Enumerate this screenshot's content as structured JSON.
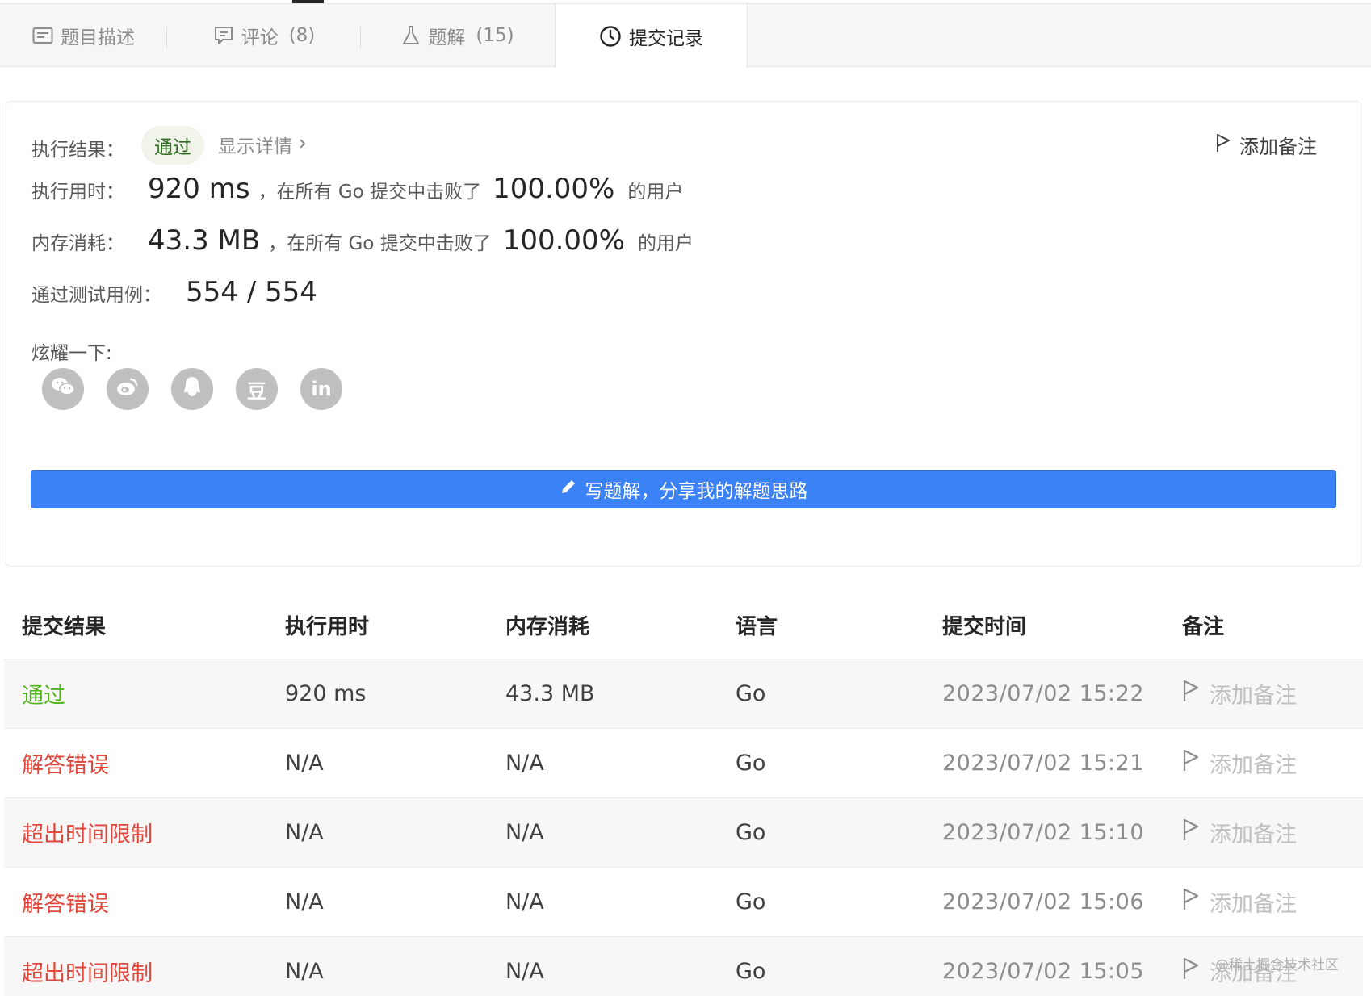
{
  "tabs": [
    {
      "label": "题目描述",
      "count": "",
      "icon": "description-icon"
    },
    {
      "label": "评论",
      "count": "(8)",
      "icon": "comment-icon"
    },
    {
      "label": "题解",
      "count": "(15)",
      "icon": "flask-icon"
    },
    {
      "label": "提交记录",
      "count": "",
      "icon": "clock-icon"
    }
  ],
  "result": {
    "result_label": "执行结果：",
    "status": "通过",
    "show_details": "显示详情",
    "add_note": "添加备注",
    "runtime_label": "执行用时：",
    "runtime_value": "920 ms",
    "runtime_mid": "，在所有 Go 提交中击败了",
    "runtime_percent": "100.00%",
    "runtime_suffix": "的用户",
    "memory_label": "内存消耗：",
    "memory_value": "43.3 MB",
    "memory_mid": "，在所有 Go 提交中击败了",
    "memory_percent": "100.00%",
    "memory_suffix": "的用户",
    "tests_label": "通过测试用例：",
    "tests_value": "554 / 554",
    "share_label": "炫耀一下:",
    "share_icons": [
      "wechat-icon",
      "weibo-icon",
      "qq-icon",
      "douban-icon",
      "linkedin-icon"
    ],
    "share_douban_glyph": "豆",
    "share_linkedin_glyph": "in",
    "write_solution": "写题解，分享我的解题思路"
  },
  "table": {
    "headers": [
      "提交结果",
      "执行用时",
      "内存消耗",
      "语言",
      "提交时间",
      "备注"
    ],
    "rows": [
      {
        "status": "通过",
        "status_color": "#52b21c",
        "runtime": "920 ms",
        "memory": "43.3 MB",
        "language": "Go",
        "time": "2023/07/02 15:22",
        "note": "添加备注"
      },
      {
        "status": "解答错误",
        "status_color": "#e2473b",
        "runtime": "N/A",
        "memory": "N/A",
        "language": "Go",
        "time": "2023/07/02 15:21",
        "note": "添加备注"
      },
      {
        "status": "超出时间限制",
        "status_color": "#e2473b",
        "runtime": "N/A",
        "memory": "N/A",
        "language": "Go",
        "time": "2023/07/02 15:10",
        "note": "添加备注"
      },
      {
        "status": "解答错误",
        "status_color": "#e2473b",
        "runtime": "N/A",
        "memory": "N/A",
        "language": "Go",
        "time": "2023/07/02 15:06",
        "note": "添加备注"
      },
      {
        "status": "超出时间限制",
        "status_color": "#e2473b",
        "runtime": "N/A",
        "memory": "N/A",
        "language": "Go",
        "time": "2023/07/02 15:05",
        "note": "添加备注"
      }
    ]
  },
  "watermark": "@稀土掘金技术社区",
  "colors": {
    "pass": "#52b21c",
    "fail": "#e2473b",
    "primary_button": "#3b82f6"
  }
}
